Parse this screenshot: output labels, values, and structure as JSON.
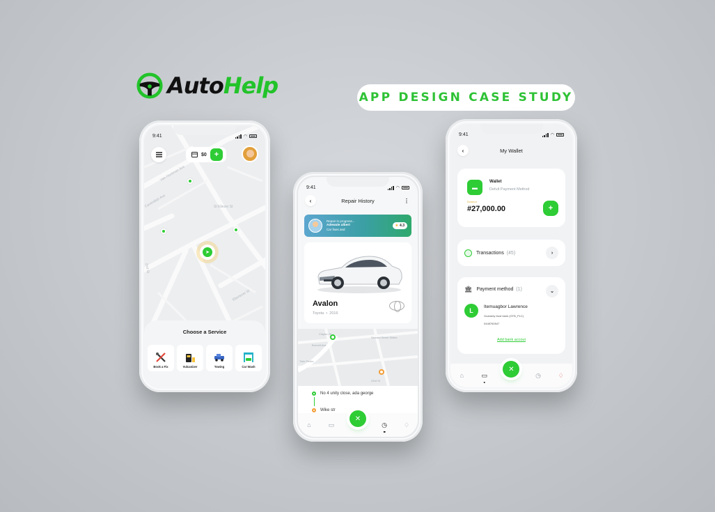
{
  "brand": {
    "auto": "Auto",
    "help": "Help",
    "green": "#22c32a"
  },
  "case_study": "APP DESIGN CASE STUDY",
  "status_time": "9:41",
  "phone_map": {
    "wallet_amount": "$0",
    "plus": "+",
    "sheet_title": "Choose a Service",
    "services": [
      {
        "label": "Book a Fix",
        "icon": "tools-icon"
      },
      {
        "label": "Vulcanizer",
        "icon": "vulcanizer-icon"
      },
      {
        "label": "Towing",
        "icon": "tow-truck-icon"
      },
      {
        "label": "Car Wash",
        "icon": "car-wash-icon"
      }
    ],
    "streets": [
      "Van Hontman Ave",
      "Cavendish Ave",
      "St Eliezer St",
      "2nd St",
      "Ebenezer St"
    ]
  },
  "phone_repair": {
    "title": "Repair History",
    "progress": {
      "status": "Repair in progress...",
      "name": "Adewale albert",
      "desc": "Car fixes and",
      "rating": "4.3"
    },
    "car": {
      "name": "Avalon",
      "make": "Toyota",
      "sep": "•",
      "year": "2016"
    },
    "map_labels": [
      "Clayton St",
      "Burnett Ave",
      "Twin Peaks",
      "Seward Street Slides",
      "23rd St"
    ],
    "route": [
      {
        "text": "No 4 unity close, ada george",
        "color": "#2ecc35"
      },
      {
        "text": "Wike str",
        "color": "#f39c34"
      }
    ]
  },
  "phone_wallet": {
    "title": "My Wallet",
    "wallet_label": "Wallet",
    "wallet_sub": "Defult Payment Method",
    "balance_label": "Balance",
    "balance": "#27,000.00",
    "plus": "+",
    "transactions_label": "Transactions",
    "transactions_count": "(45)",
    "payment_label": "Payment method",
    "payment_count": "(1)",
    "account": {
      "initial": "L",
      "name": "Itemuagbor Lawrence",
      "bank": "Guaranty trust bank (GTB_PLC)",
      "number": "0448760547"
    },
    "add_bank": "Add bank accout"
  }
}
